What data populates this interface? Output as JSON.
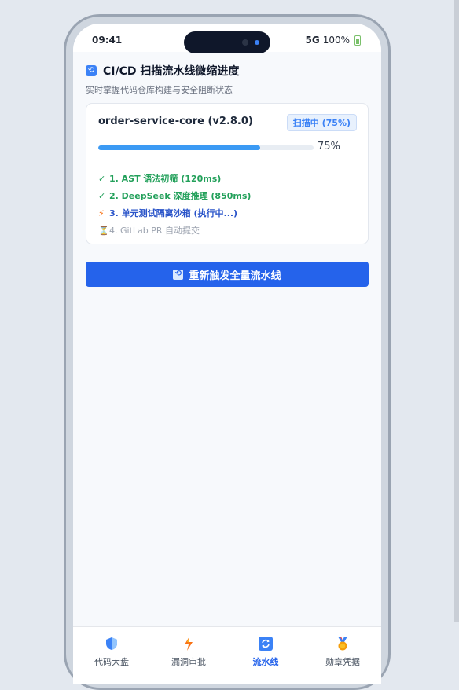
{
  "status_bar": {
    "time": "09:41",
    "network": "5G",
    "battery": "100%"
  },
  "header": {
    "title": "CI/CD 扫描流水线微缩进度",
    "subtitle": "实时掌握代码仓库构建与安全阻断状态"
  },
  "pipeline": {
    "project": "order-service-core (v2.8.0)",
    "status_badge": "扫描中 (75%)",
    "progress_percent": 75,
    "progress_label": "75%",
    "steps": [
      {
        "state": "done",
        "icon": "✓",
        "label": "1. AST 语法初筛 (120ms)"
      },
      {
        "state": "done",
        "icon": "✓",
        "label": "2. DeepSeek 深度推理 (850ms)"
      },
      {
        "state": "running",
        "icon": "⚡",
        "label": "3. 单元测试隔离沙箱 (执行中...)"
      },
      {
        "state": "pending",
        "icon": "⏳",
        "label": "4. GitLab PR 自动提交"
      }
    ]
  },
  "actions": {
    "rerun_label": "重新触发全量流水线"
  },
  "bottom_nav": {
    "items": [
      {
        "label": "代码大盘",
        "icon": "shield-icon",
        "active": false
      },
      {
        "label": "漏洞审批",
        "icon": "lightning-icon",
        "active": false
      },
      {
        "label": "流水线",
        "icon": "refresh-icon",
        "active": true
      },
      {
        "label": "勋章凭据",
        "icon": "medal-icon",
        "active": false
      }
    ]
  },
  "colors": {
    "accent": "#2563eb",
    "progress": "#3b9af4",
    "done": "#22a05a",
    "running": "#2a54c9",
    "pending": "#9ca3af"
  }
}
